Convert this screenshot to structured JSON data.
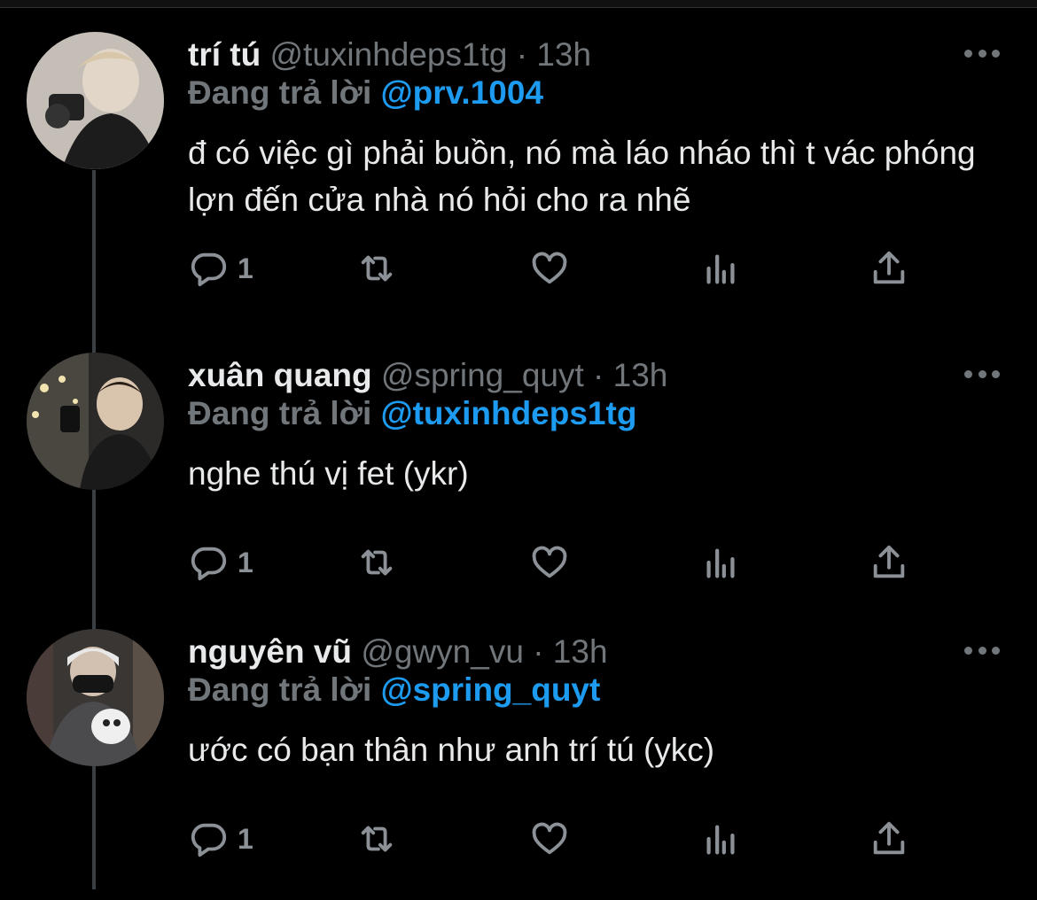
{
  "icons": {
    "reply": "reply-bubble-icon",
    "retweet": "retweet-icon",
    "like": "heart-icon",
    "views": "analytics-bars-icon",
    "share": "share-upload-icon",
    "more": "more-dots-icon"
  },
  "colors": {
    "background": "#000000",
    "text": "#e7e9ea",
    "muted": "#71767b",
    "mention": "#1d9bf0",
    "thread_line": "#3a3f43"
  },
  "tweets": [
    {
      "name": "trí tú",
      "handle": "@tuxinhdeps1tg",
      "time": "· 13h",
      "reply_prefix": "Đang trả lời",
      "reply_to": "@prv.1004",
      "text": "đ có việc gì phải buồn, nó mà láo nháo thì t vác phóng lợn đến cửa nhà nó hỏi cho ra nhẽ",
      "reply_count": "1"
    },
    {
      "name": "xuân quang",
      "handle": "@spring_quyt",
      "time": "· 13h",
      "reply_prefix": "Đang trả lời",
      "reply_to": "@tuxinhdeps1tg",
      "text": "nghe thú vị fet (ykr)",
      "reply_count": "1"
    },
    {
      "name": "nguyên vũ",
      "handle": "@gwyn_vu",
      "time": "· 13h",
      "reply_prefix": "Đang trả lời",
      "reply_to": "@spring_quyt",
      "text": "ước có bạn thân như anh trí tú (ykc)",
      "reply_count": "1"
    }
  ]
}
